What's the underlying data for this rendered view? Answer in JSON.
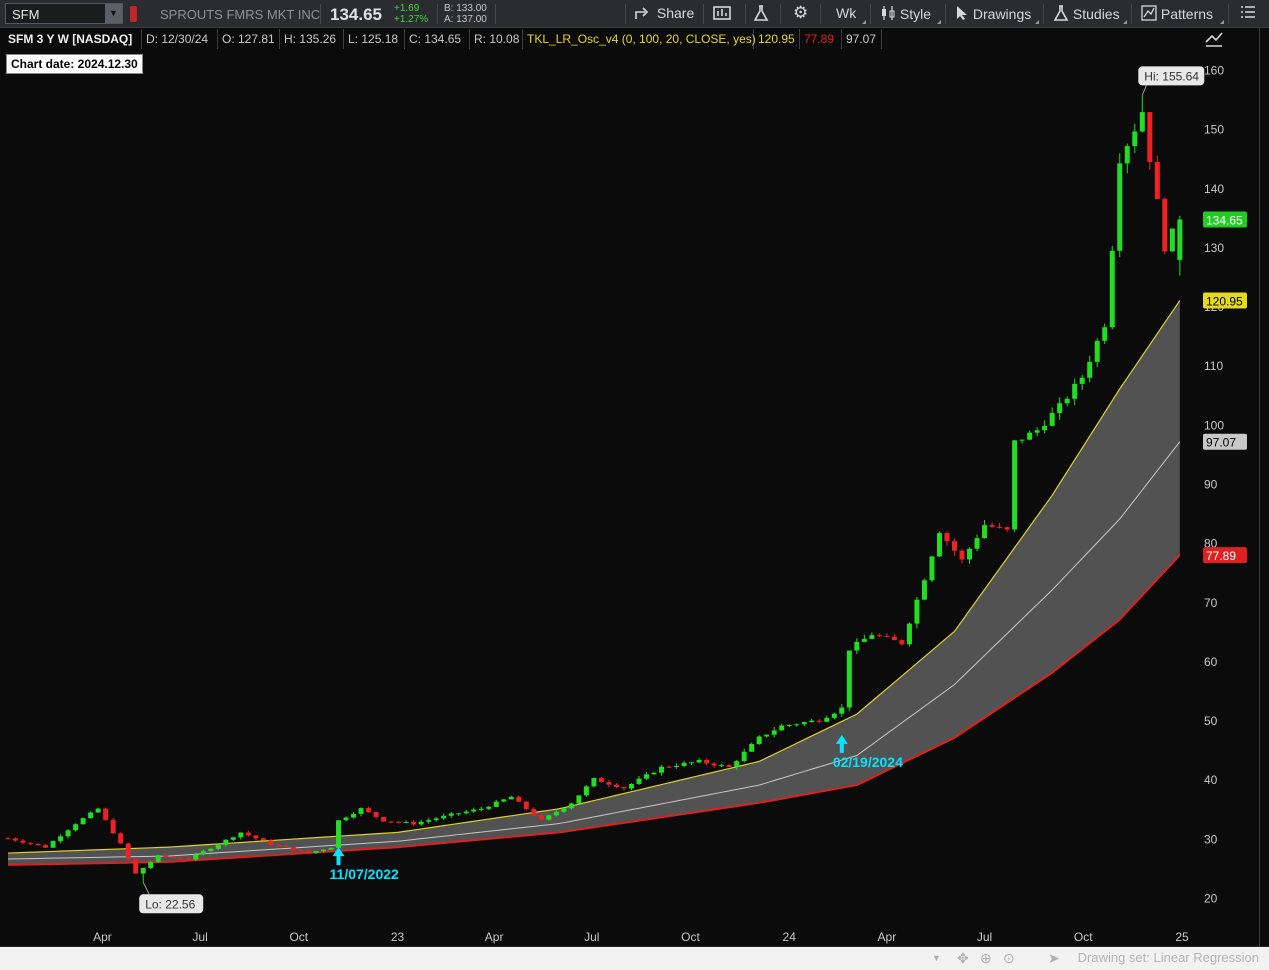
{
  "toolbar": {
    "symbol": "SFM",
    "company": "SPROUTS FMRS MKT INC",
    "last": "134.65",
    "change": "+1.69",
    "change_pct": "+1.27%",
    "bid": "B: 133.00",
    "ask": "A: 137.00",
    "share": "Share",
    "period": "Wk",
    "style": "Style",
    "drawings": "Drawings",
    "studies": "Studies",
    "patterns": "Patterns"
  },
  "info": {
    "title": "SFM 3 Y W [NASDAQ]",
    "date": "D: 12/30/24",
    "open": "O: 127.81",
    "high": "H: 135.26",
    "low": "L: 125.18",
    "close": "C: 134.65",
    "range": "R: 10.08",
    "study": "TKL_LR_Osc_v4 (0, 100, 20, CLOSE, yes)",
    "study_v1": "120.95",
    "study_v2": "77.89",
    "study_v3": "97.07"
  },
  "chart_date": "Chart date:  2024.12.30",
  "bottom": {
    "drawing_set": "Drawing set: Linear Regression"
  },
  "colors": {
    "up": "#22dd22",
    "down": "#ee2222",
    "upper_band": "#e0d020",
    "lower_band": "#dd2020",
    "mid_line": "#c8c8c8",
    "band_fill": "#5a5a5a",
    "arrow": "#00e5ff",
    "background": "#0b0b0b"
  },
  "chart_data": {
    "type": "candlestick",
    "ylim": [
      15,
      165
    ],
    "y_ticks": [
      20,
      30,
      40,
      50,
      60,
      70,
      80,
      90,
      100,
      110,
      120,
      130,
      140,
      150,
      160
    ],
    "x_ticks": [
      {
        "label": "Apr",
        "date": "2022-04-01"
      },
      {
        "label": "Jul",
        "date": "2022-07-01"
      },
      {
        "label": "Oct",
        "date": "2022-10-01"
      },
      {
        "label": "23",
        "date": "2023-01-01"
      },
      {
        "label": "Apr",
        "date": "2023-04-01"
      },
      {
        "label": "Jul",
        "date": "2023-07-01"
      },
      {
        "label": "Oct",
        "date": "2023-10-01"
      },
      {
        "label": "24",
        "date": "2024-01-01"
      },
      {
        "label": "Apr",
        "date": "2024-04-01"
      },
      {
        "label": "Jul",
        "date": "2024-07-01"
      },
      {
        "label": "Oct",
        "date": "2024-10-01"
      },
      {
        "label": "25",
        "date": "2025-01-01"
      }
    ],
    "close_anchors": [
      [
        "2022-01-03",
        30
      ],
      [
        "2022-02-07",
        28.5
      ],
      [
        "2022-03-07",
        32.5
      ],
      [
        "2022-03-28",
        35
      ],
      [
        "2022-04-18",
        29
      ],
      [
        "2022-05-02",
        24
      ],
      [
        "2022-05-23",
        27
      ],
      [
        "2022-06-20",
        26.5
      ],
      [
        "2022-07-18",
        29
      ],
      [
        "2022-08-08",
        31
      ],
      [
        "2022-09-05",
        29
      ],
      [
        "2022-10-10",
        27.5
      ],
      [
        "2022-10-31",
        28.5
      ],
      [
        "2022-11-07",
        33
      ],
      [
        "2022-11-28",
        35
      ],
      [
        "2022-12-19",
        33
      ],
      [
        "2023-01-16",
        32.5
      ],
      [
        "2023-02-20",
        34
      ],
      [
        "2023-03-20",
        35
      ],
      [
        "2023-04-17",
        37
      ],
      [
        "2023-05-15",
        33
      ],
      [
        "2023-06-12",
        36
      ],
      [
        "2023-07-03",
        40
      ],
      [
        "2023-07-31",
        38.5
      ],
      [
        "2023-09-04",
        42
      ],
      [
        "2023-10-09",
        43
      ],
      [
        "2023-11-06",
        42
      ],
      [
        "2023-12-04",
        47
      ],
      [
        "2023-12-25",
        49
      ],
      [
        "2024-01-29",
        50
      ],
      [
        "2024-02-19",
        52
      ],
      [
        "2024-02-26",
        62
      ],
      [
        "2024-03-18",
        64.5
      ],
      [
        "2024-04-15",
        63
      ],
      [
        "2024-05-06",
        74
      ],
      [
        "2024-05-20",
        82
      ],
      [
        "2024-06-10",
        77
      ],
      [
        "2024-07-01",
        83
      ],
      [
        "2024-07-22",
        82
      ],
      [
        "2024-07-29",
        97
      ],
      [
        "2024-08-19",
        99
      ],
      [
        "2024-09-09",
        103
      ],
      [
        "2024-09-30",
        108
      ],
      [
        "2024-10-21",
        117
      ],
      [
        "2024-10-28",
        130
      ],
      [
        "2024-11-04",
        145
      ],
      [
        "2024-11-18",
        150
      ],
      [
        "2024-11-25",
        153
      ],
      [
        "2024-12-02",
        145
      ],
      [
        "2024-12-16",
        130
      ],
      [
        "2024-12-30",
        134.65
      ]
    ],
    "last_bar": {
      "date": "2024-12-30",
      "open": 127.81,
      "high": 135.26,
      "low": 125.18,
      "close": 134.65
    },
    "bands": {
      "upper": [
        [
          "2022-01-03",
          27.5
        ],
        [
          "2022-06-01",
          28.5
        ],
        [
          "2023-01-01",
          31
        ],
        [
          "2023-06-01",
          35
        ],
        [
          "2023-12-04",
          43
        ],
        [
          "2024-03-04",
          51
        ],
        [
          "2024-06-03",
          65
        ],
        [
          "2024-09-02",
          88
        ],
        [
          "2024-11-04",
          106
        ],
        [
          "2024-12-30",
          120.95
        ]
      ],
      "mid": [
        [
          "2022-01-03",
          26.5
        ],
        [
          "2022-06-01",
          27
        ],
        [
          "2023-01-01",
          29.5
        ],
        [
          "2023-06-01",
          32.5
        ],
        [
          "2023-12-04",
          39
        ],
        [
          "2024-03-04",
          44
        ],
        [
          "2024-06-03",
          56
        ],
        [
          "2024-09-02",
          72
        ],
        [
          "2024-11-04",
          84
        ],
        [
          "2024-12-30",
          97.07
        ]
      ],
      "lower": [
        [
          "2022-01-03",
          25.5
        ],
        [
          "2022-06-01",
          26
        ],
        [
          "2023-01-01",
          28.5
        ],
        [
          "2023-06-01",
          31
        ],
        [
          "2023-12-04",
          36
        ],
        [
          "2024-03-04",
          39
        ],
        [
          "2024-06-03",
          47
        ],
        [
          "2024-09-02",
          58
        ],
        [
          "2024-11-04",
          67
        ],
        [
          "2024-12-30",
          77.89
        ]
      ]
    },
    "hi_label": "Hi: 155.64",
    "hi_value": 155.64,
    "hi_date": "2024-11-25",
    "lo_label": "Lo: 22.56",
    "lo_value": 22.56,
    "lo_date": "2022-05-09",
    "arrows": [
      {
        "date": "2022-11-07",
        "value": 28.5,
        "label": "11/07/2022"
      },
      {
        "date": "2024-02-19",
        "value": 47.5,
        "label": "02/19/2024"
      }
    ],
    "price_labels": [
      {
        "value": 134.65,
        "text": "134.65",
        "bg": "#22cc22",
        "fg": "#ffffff"
      },
      {
        "value": 120.95,
        "text": "120.95",
        "bg": "#e6d81f",
        "fg": "#000000"
      },
      {
        "value": 97.07,
        "text": "97.07",
        "bg": "#c8c8c8",
        "fg": "#000000"
      },
      {
        "value": 77.89,
        "text": "77.89",
        "bg": "#dd2020",
        "fg": "#ffffff"
      }
    ]
  }
}
